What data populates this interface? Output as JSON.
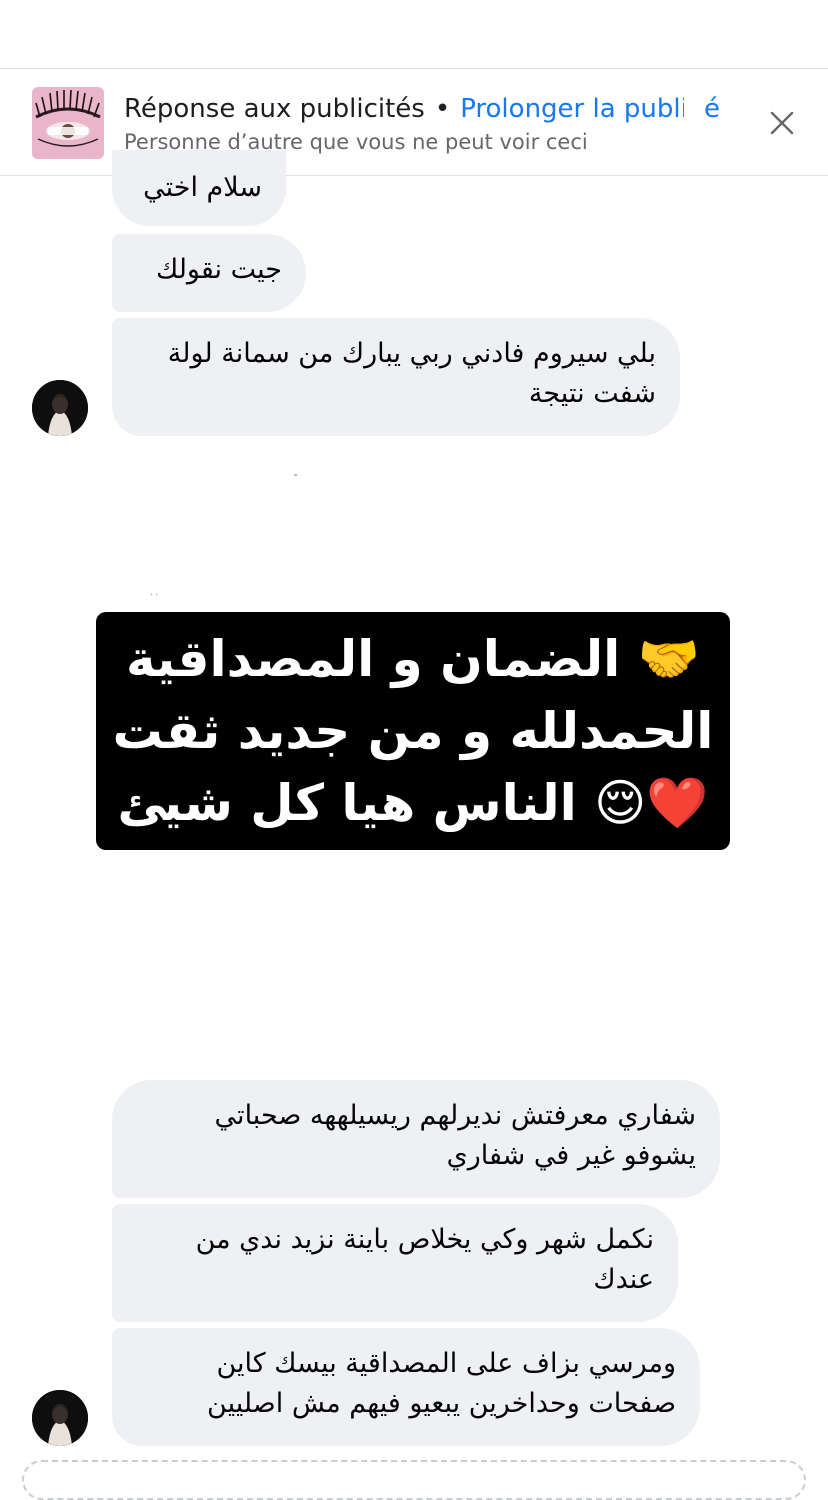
{
  "ad_banner": {
    "title": "Réponse aux publicités",
    "separator": "•",
    "extend_link": "Prolonger la publicité",
    "extend_link_tail": "é",
    "subtitle": "Personne d’autre que vous ne peut voir ceci",
    "thumbnail_caption": "lashes-ad",
    "close_icon": "close-icon"
  },
  "messages_top": [
    {
      "text": "سلام اختي"
    },
    {
      "text": "جيت نقولك"
    },
    {
      "lines": [
        "بلي سيروم فادني ربي يبارك من سمانة لولة",
        "شفت نتيجة"
      ]
    }
  ],
  "image_message": {
    "lines": [
      "🤝 الضمان و المصداقية",
      "الحمدلله و من جديد ثقت",
      "❤️😌 الناس هيا كل شيئ"
    ],
    "background": "#000000",
    "text_color": "#ffffff"
  },
  "messages_bottom": [
    {
      "lines": [
        "شفاري معرفتش نديرلهم ريسيلههه صحباتي",
        "يشوفو غير في شفاري"
      ]
    },
    {
      "lines": [
        "نكمل شهر وكي يخلاص باينة نزيد ندي من",
        "عندك"
      ]
    },
    {
      "lines": [
        "ومرسي بزاف على المصداقية بيسك كاين",
        "صفحات وحداخرين يبعيو فيهم مش اصليين"
      ]
    }
  ],
  "colors": {
    "bubble": "#eef0f3",
    "link": "#1877f2",
    "secondary_text": "#65676b",
    "divider": "#dddfe2"
  }
}
